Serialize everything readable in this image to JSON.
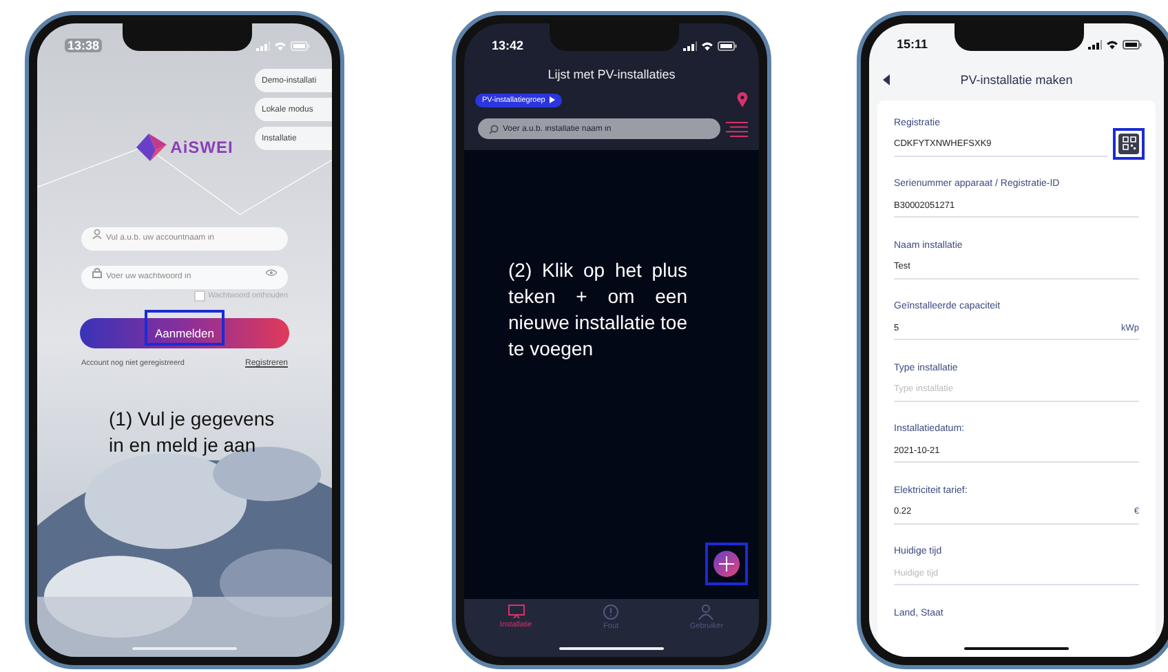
{
  "login_screen": {
    "time": "13:38",
    "mode_buttons": [
      "Demo-installati",
      "Lokale modus",
      "Installatie"
    ],
    "logo": "AiSWEI",
    "username": {
      "placeholder": "Vul a.u.b. uw accountnaam in"
    },
    "password": {
      "placeholder": "Voer uw wachtwoord in"
    },
    "remember": {
      "label": "Wachtwoord onthouden",
      "checked": false
    },
    "login_button": {
      "label": "Aanmelden",
      "highlighted": true
    },
    "links": [
      "Account nog niet geregistreerd",
      "Registreren"
    ],
    "annotation": "(1) Vul je gegevens in en meld je aan"
  },
  "list_screen": {
    "time": "13:42",
    "title": "Lijst met PV-installaties",
    "group_chip": "PV-installatiegroep",
    "search": {
      "placeholder": "Voer a.u.b. installatie naam in"
    },
    "annotation": "(2) Klik op het plus teken + om een nieuwe installatie toe te voegen",
    "add_button": {
      "highlighted": true
    },
    "tabs": [
      {
        "label": "Installatie",
        "selected": true
      },
      {
        "label": "Fout",
        "selected": false
      },
      {
        "label": "Gebruiker",
        "selected": false
      }
    ]
  },
  "form_screen": {
    "time": "15:11",
    "title": "PV-installatie maken",
    "fields": [
      {
        "label": "Registratie",
        "value": "CDKFYTXNWHEFSXK9",
        "scan": {
          "highlighted": true
        }
      },
      {
        "label": "Serienummer apparaat / Registratie-ID",
        "value": "B30002051271"
      },
      {
        "label": "Naam installatie",
        "value": "Test"
      },
      {
        "label": "Geïnstalleerde capaciteit",
        "value": "5",
        "unit": "kWp"
      },
      {
        "label": "Type installatie",
        "placeholder": "Type installatie"
      },
      {
        "label": "Installatiedatum:",
        "value": "2021-10-21"
      },
      {
        "label": "Elektriciteit tarief:",
        "value": "0.22",
        "unit": "€"
      },
      {
        "label": "Huidige tijd",
        "placeholder": "Huidige tijd"
      },
      {
        "label": "Land, Staat"
      }
    ]
  }
}
